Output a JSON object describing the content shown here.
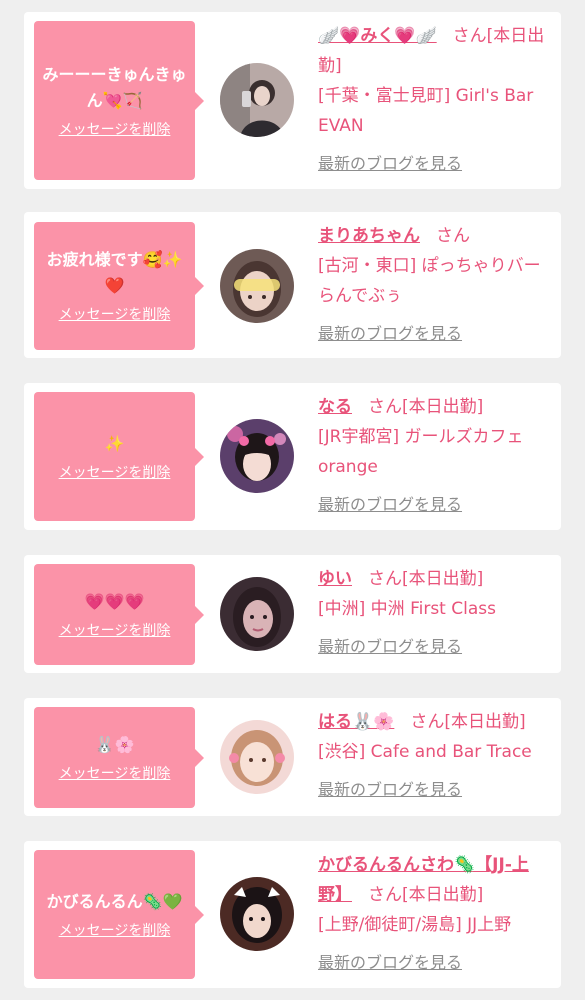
{
  "delete_label": "メッセージを削除",
  "blog_label": "最新のブログを見る",
  "san_suffix": "さん",
  "items": [
    {
      "message": "みーーーきゅんきゅん💘🏹",
      "name": "🪽💗みく💗🪽",
      "status": "[本日出勤]",
      "shop": "[千葉・富士見町] Girl's Bar EVAN",
      "avatar_icon": "profile-photo"
    },
    {
      "message": "お疲れ様です🥰✨❤️",
      "name": "まりあちゃん",
      "status": "",
      "shop": "[古河・東口] ぽっちゃりバー らんでぶぅ",
      "avatar_icon": "profile-photo"
    },
    {
      "message": "✨",
      "name": "なる",
      "status": "[本日出勤]",
      "shop": "[JR宇都宮] ガールズカフェ orange",
      "avatar_icon": "profile-photo"
    },
    {
      "message": "💗💗💗",
      "name": "ゆい",
      "status": "[本日出勤]",
      "shop": "[中洲] 中洲 First Class",
      "avatar_icon": "profile-photo"
    },
    {
      "message": "🐰🌸",
      "name": "はる🐰🌸",
      "status": "[本日出勤]",
      "shop": "[渋谷] Cafe and Bar Trace",
      "avatar_icon": "profile-photo"
    },
    {
      "message": "かびるんるん🦠💚",
      "name": "かびるんるんさわ🦠【JJ-上野】",
      "status": "[本日出勤]",
      "shop": "[上野/御徒町/湯島] JJ上野",
      "avatar_icon": "profile-photo"
    }
  ],
  "colors": {
    "bubble": "#fb93a8",
    "accent_text": "#e8537a",
    "link_gray": "#8d8d8d",
    "page_bg": "#efefef"
  }
}
